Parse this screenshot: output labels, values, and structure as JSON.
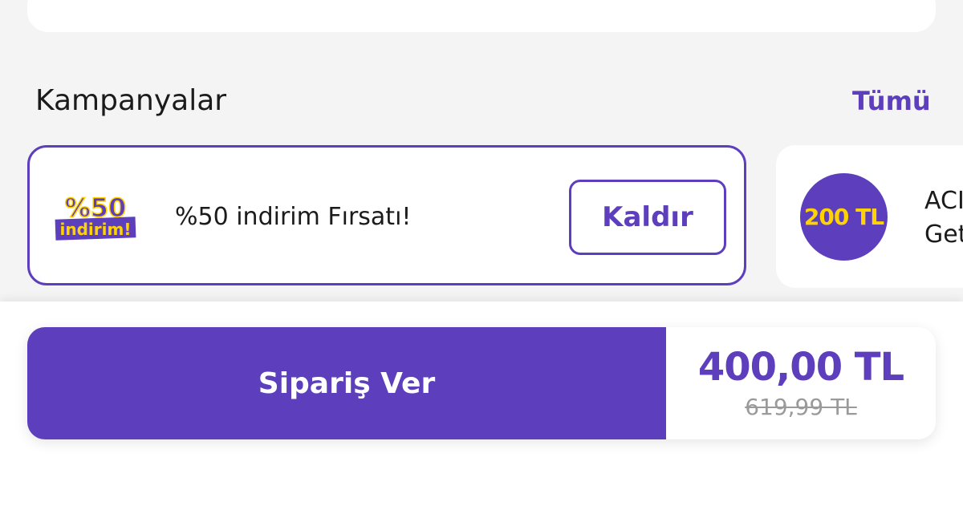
{
  "section": {
    "title": "Kampanyalar",
    "see_all": "Tümü"
  },
  "campaigns": [
    {
      "logo_text_top": "%50",
      "logo_text_bottom": "indirim!",
      "text": "%50 indirim Fırsatı!",
      "action_label": "Kaldır"
    },
    {
      "badge": "200 TL",
      "text_line1": "ACI",
      "text_line2": "Get"
    }
  ],
  "checkout": {
    "button_label": "Sipariş Ver",
    "price_current": "400,00 TL",
    "price_old": "619,99 TL"
  },
  "colors": {
    "brand_purple": "#5d3ebc",
    "accent_yellow": "#ffd300",
    "background": "#f4f4f4"
  }
}
